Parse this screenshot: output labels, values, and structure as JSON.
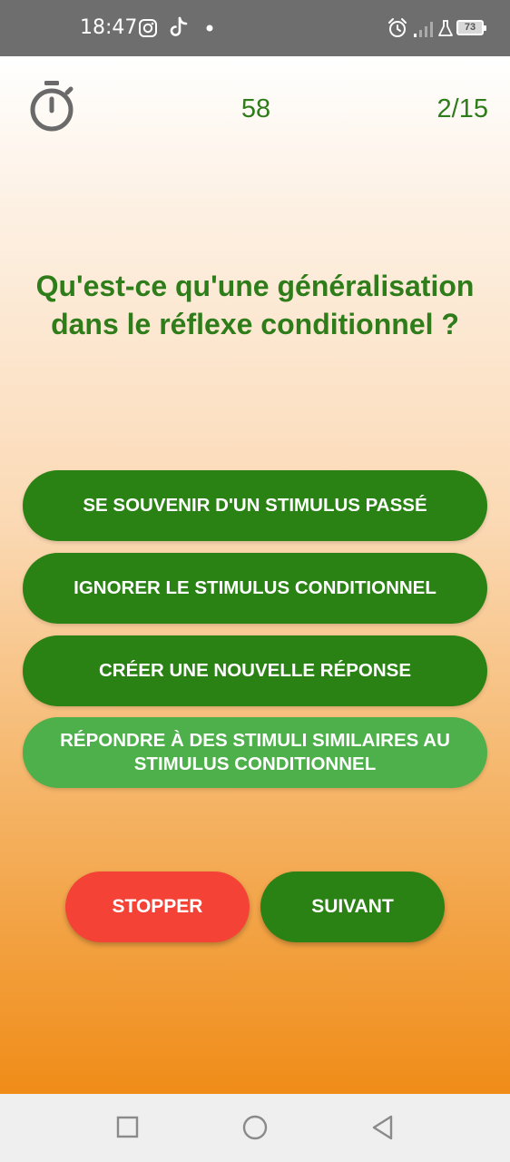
{
  "status_bar": {
    "time": "18:47",
    "icons": [
      "instagram-icon",
      "tiktok-icon",
      "dot-icon",
      "alarm-icon",
      "signal-icon",
      "flask-icon",
      "battery-icon"
    ],
    "battery_level": "73"
  },
  "header": {
    "timer_icon": "stopwatch-icon",
    "countdown": "58",
    "progress": "2/15"
  },
  "question": {
    "line1": "Qu'est-ce qu'une généralisation",
    "line2": "dans le réflexe conditionnel ?"
  },
  "answers": [
    {
      "label": "SE SOUVENIR D'UN STIMULUS PASSÉ",
      "selected": false
    },
    {
      "label": "IGNORER LE STIMULUS CONDITIONNEL",
      "selected": false
    },
    {
      "label": "CRÉER UNE NOUVELLE RÉPONSE",
      "selected": false
    },
    {
      "label": "RÉPONDRE À DES STIMULI SIMILAIRES AU STIMULUS CONDITIONNEL",
      "selected": true
    }
  ],
  "actions": {
    "stop_label": "STOPPER",
    "next_label": "SUIVANT"
  },
  "colors": {
    "primary_green": "#2a8214",
    "selected_green": "#4db04a",
    "stop_red": "#f44336",
    "text_green": "#2e7d1a",
    "gradient_bottom": "#f08c18"
  },
  "nav_bar": {
    "icons": [
      "recent-apps-icon",
      "home-icon",
      "back-icon"
    ]
  }
}
